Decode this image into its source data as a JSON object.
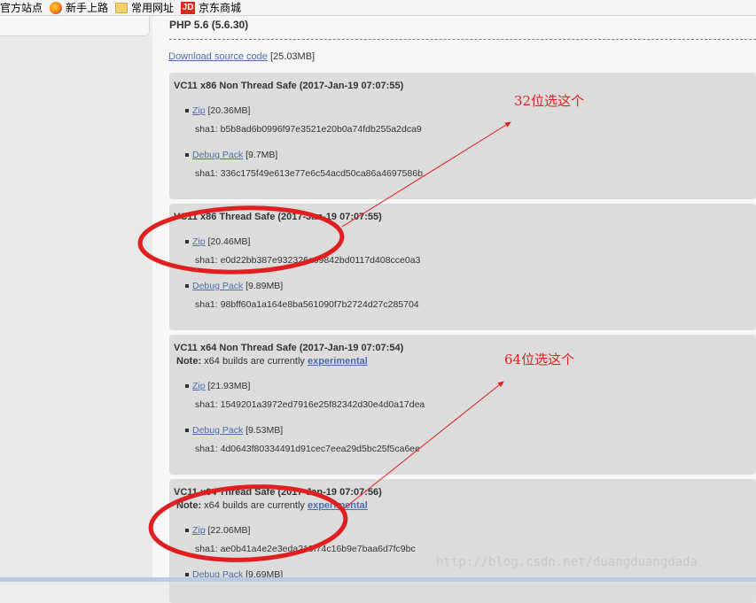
{
  "bookmarks": [
    {
      "label": "官方站点",
      "icon": "none"
    },
    {
      "label": "新手上路",
      "icon": "firefox-icon"
    },
    {
      "label": "常用网址",
      "icon": "folder-icon"
    },
    {
      "label": "京东商城",
      "icon": "jd-icon",
      "icon_text": "JD"
    }
  ],
  "page": {
    "version_title": "PHP 5.6 (5.6.30)",
    "download_source_label": "Download source code",
    "download_source_size": "[25.03MB]"
  },
  "builds": [
    {
      "title": "VC11 x86 Non Thread Safe (2017-Jan-19 07:07:55)",
      "note_label": "",
      "note_text": "",
      "note_link": "",
      "zip_label": "Zip",
      "zip_size": "[20.36MB]",
      "zip_sha": "sha1: b5b8ad6b0996f97e3521e20b0a74fdb255a2dca9",
      "debug_label": "Debug Pack",
      "debug_size": "[9.7MB]",
      "debug_sha": "sha1: 336c175f49e613e77e6c54acd50ca86a4697586b"
    },
    {
      "title": "VC11 x86 Thread Safe (2017-Jan-19 07:07:55)",
      "note_label": "",
      "note_text": "",
      "note_link": "",
      "zip_label": "Zip",
      "zip_size": "[20.46MB]",
      "zip_sha": "sha1: e0d22bb387e932326a09842bd0117d408cce0a3",
      "debug_label": "Debug Pack",
      "debug_size": "[9.89MB]",
      "debug_sha": "sha1: 98bff60a1a164e8ba561090f7b2724d27c285704"
    },
    {
      "title": "VC11 x64 Non Thread Safe (2017-Jan-19 07:07:54)",
      "note_label": "Note:",
      "note_text": "x64 builds are currently",
      "note_link": "experimental",
      "zip_label": "Zip",
      "zip_size": "[21.93MB]",
      "zip_sha": "sha1: 1549201a3972ed7916e25f82342d30e4d0a17dea",
      "debug_label": "Debug Pack",
      "debug_size": "[9.53MB]",
      "debug_sha": "sha1: 4d0643f80334491d91cec7eea29d5bc25f5ca6ee"
    },
    {
      "title": "VC11 x64 Thread Safe (2017-Jan-19 07:07:56)",
      "note_label": "Note:",
      "note_text": "x64 builds are currently",
      "note_link": "experimental",
      "zip_label": "Zip",
      "zip_size": "[22.06MB]",
      "zip_sha": "sha1: ae0b41a4e2e3eda219f74c16b9e7baa6d7fc9bc",
      "debug_label": "Debug Pack",
      "debug_size": "[9.69MB]",
      "debug_sha": ""
    }
  ],
  "annotations": {
    "label_32": "32位选这个",
    "label_64": "64位选这个",
    "color": "#e02020"
  },
  "watermark": "http://blog.csdn.net/duangduangdada"
}
